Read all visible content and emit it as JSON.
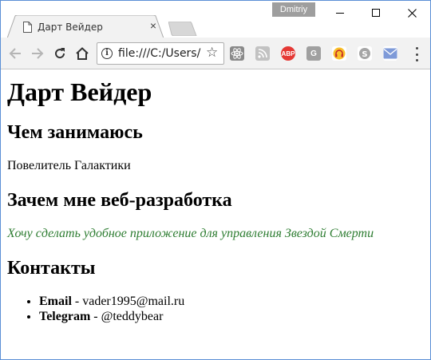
{
  "browser": {
    "profile_name": "Dmitriy",
    "tab": {
      "title": "Дарт Вейдер",
      "close_glyph": "×"
    },
    "omnibox": {
      "info_glyph": "i",
      "url": "file:///C:/Users/U",
      "star_glyph": "☆"
    },
    "extensions": [
      {
        "name": "react-devtools-icon",
        "color": "#7b7b7b"
      },
      {
        "name": "rss-icon",
        "color": "#bdbdbd"
      },
      {
        "name": "adblock-icon",
        "color": "#e53935",
        "label": "ABP"
      },
      {
        "name": "google-extension-icon",
        "color": "#9e9e9e",
        "label": "G"
      },
      {
        "name": "extension-g-icon",
        "color": "#8d8d8d",
        "label": "G"
      },
      {
        "name": "headphones-icon",
        "color": "#f9a825"
      },
      {
        "name": "skype-icon",
        "color": "#9e9e9e"
      },
      {
        "name": "mail-icon",
        "color": "#6f8fd6"
      }
    ]
  },
  "page": {
    "title": "Дарт Вейдер",
    "section1": {
      "heading": "Чем занимаюсь",
      "text": "Повелитель Галактики"
    },
    "section2": {
      "heading": "Зачем мне веб-разработка",
      "text": "Хочу сделать удобное приложение для управления Звездой Смерти"
    },
    "section3": {
      "heading": "Контакты",
      "items": [
        {
          "label": "Email",
          "separator": " - ",
          "value": "vader1995@mail.ru"
        },
        {
          "label": "Telegram",
          "separator": " - ",
          "value": "@teddybear"
        }
      ]
    },
    "colors": {
      "accent_text": "#2e7d32"
    }
  }
}
